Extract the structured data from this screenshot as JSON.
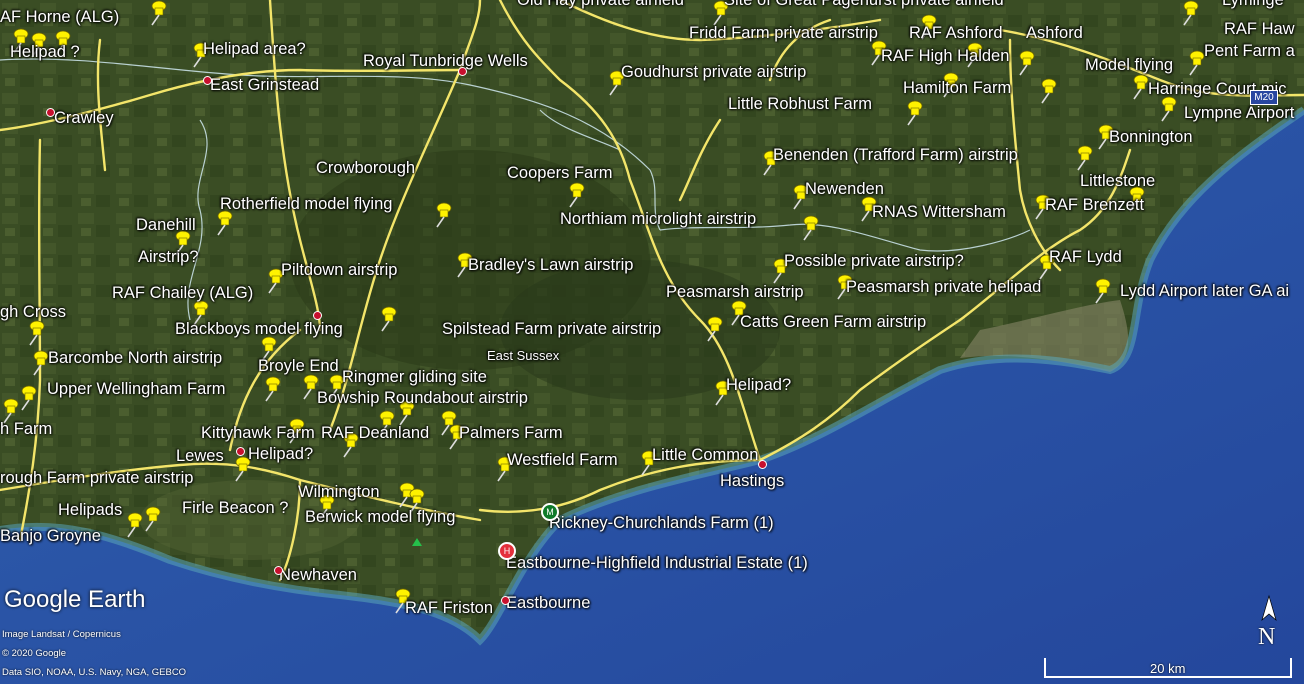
{
  "map": {
    "colors": {
      "land": "#3a4d24",
      "sea": "#2a4ea5",
      "road": "#f3e56a",
      "boundary": "#cfe8f0",
      "pin": "#fff200"
    },
    "region_label": "East Sussex",
    "labels": [
      "AF Horne (ALG)",
      "Helipad ?",
      "Helipad area?",
      "East Grinstead",
      "Crawley",
      "Royal Tunbridge Wells",
      "Old Hay private airfield",
      "Site of Great Pagehurst private airfield",
      "Fridd Farm private airstrip",
      "RAF Ashford",
      "Ashford",
      "RAF High Halden",
      "RAF Haw",
      "Pent Farm a",
      "Model flying",
      "Harringe Court mic",
      "Lympne Airport",
      "Goudhurst private airstrip",
      "Hamilton Farm",
      "Little Robhust Farm",
      "Bonnington",
      "Benenden (Trafford Farm) airstrip",
      "Littlestone",
      "Crowborough",
      "Coopers Farm",
      "Newenden",
      "RAF Brenzett",
      "Rotherfield model flying",
      "RNAS Wittersham",
      "Northiam microlight airstrip",
      "Danehill",
      "Airstrip?",
      "RAF Lydd",
      "Possible private airstrip?",
      "Piltdown airstrip",
      "Bradley's Lawn airstrip",
      "RAF Chailey (ALG)",
      "Peasmarsh private helipad",
      "Lydd Airport later GA ai",
      "Peasmarsh airstrip",
      "gh Cross",
      "Catts Green Farm airstrip",
      "Blackboys model flying",
      "Spilstead Farm private airstrip",
      "East Sussex",
      "Barcombe North airstrip",
      "Broyle End",
      "Ringmer gliding site",
      "Upper Wellingham Farm",
      "Helipad?",
      "Bowship Roundabout airstrip",
      "h Farm",
      "Kittyhawk Farm",
      "RAF Deanland",
      "Palmers Farm",
      "Lewes",
      "Helipad?",
      "Westfield Farm",
      "Little Common",
      "rough Farm private airstrip",
      "Hastings",
      "Wilmington",
      "Helipads",
      "Firle Beacon ?",
      "Berwick model flying",
      "Rickney-Churchlands Farm (1)",
      "Banjo Groyne",
      "Eastbourne-Highfield Industrial Estate (1)",
      "Newhaven",
      "RAF Friston",
      "Eastbourne",
      "Lyminge"
    ],
    "road_sign": "M20",
    "poi_icons": [
      "M",
      "H"
    ]
  },
  "overlay": {
    "logo": "Google Earth",
    "credits": [
      "Image Landsat / Copernicus",
      "© 2020 Google",
      "Data SIO, NOAA, U.S. Navy, NGA, GEBCO"
    ],
    "compass_letter": "N",
    "scale_label": "20 km"
  }
}
